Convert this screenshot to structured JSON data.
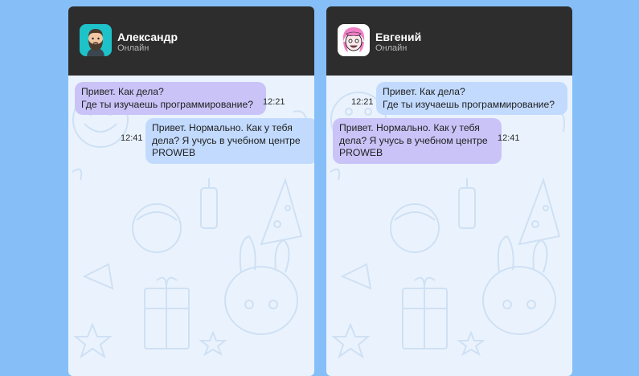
{
  "chats": [
    {
      "contact_name": "Александр",
      "contact_status": "Онлайн",
      "messages": [
        {
          "text": "Привет. Как дела?\nГде ты изучаешь программирование?",
          "time": "12:21"
        },
        {
          "text": "Привет. Нормально. Как у тебя\nдела? Я учусь в учебном центре\nPROWEB",
          "time": "12:41"
        }
      ]
    },
    {
      "contact_name": "Евгений",
      "contact_status": "Онлайн",
      "messages": [
        {
          "text": "Привет. Как дела?\nГде ты изучаешь программирование?",
          "time": "12:21"
        },
        {
          "text": "Привет. Нормально. Как у тебя\nдела? Я учусь в учебном центре\nPROWEB",
          "time": "12:41"
        }
      ]
    }
  ],
  "colors": {
    "page_background": "#86bff7",
    "header": "#2d2d2d",
    "chat_background": "#eaf3fd",
    "bubble_purple": "#c9c3f7",
    "bubble_blue": "#c2dafe",
    "avatar_teal": "#1ec3c9"
  },
  "icons": [
    "avatar-bearded-man-icon",
    "avatar-girl-icon",
    "party-doodle-wallpaper"
  ]
}
